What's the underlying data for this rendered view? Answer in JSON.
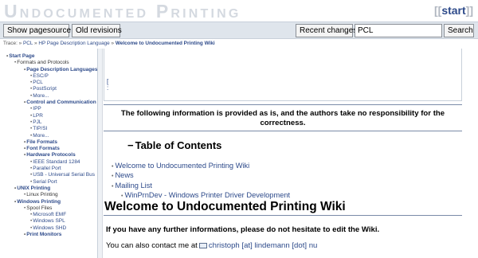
{
  "header": {
    "site_title": "Undocumented Printing",
    "start_prefix": "[[",
    "start_link": "start",
    "start_suffix": "]]"
  },
  "toolbar": {
    "show_pagesource": "Show pagesource",
    "old_revisions": "Old revisions",
    "recent_changes": "Recent changes",
    "search_value": "PCL",
    "search_button": "Search"
  },
  "trace": {
    "label": "Trace:",
    "items": [
      "PCL",
      "HP Page Description Language"
    ],
    "current": "Welcome to Undocumented Printing Wiki"
  },
  "sidebar": {
    "items": [
      {
        "label": "Start Page",
        "level": 0
      },
      {
        "label": "Formats and Protocols",
        "level": 1
      },
      {
        "label": "Page Description Languages",
        "level": 2
      },
      {
        "label": "ESC/P",
        "level": 3
      },
      {
        "label": "PCL",
        "level": 3
      },
      {
        "label": "PostScript",
        "level": 3
      },
      {
        "label": "More...",
        "level": 3
      },
      {
        "label": "Control and Communication",
        "level": 2
      },
      {
        "label": "IPP",
        "level": 3
      },
      {
        "label": "LPR",
        "level": 3
      },
      {
        "label": "PJL",
        "level": 3
      },
      {
        "label": "TIP/SI",
        "level": 3
      },
      {
        "label": "More...",
        "level": 3
      },
      {
        "label": "File Formats",
        "level": 2
      },
      {
        "label": "Font Formats",
        "level": 2
      },
      {
        "label": "Hardware Protocols",
        "level": 2
      },
      {
        "label": "IEEE Standard 1284",
        "level": 3
      },
      {
        "label": "Parallel Port",
        "level": 3
      },
      {
        "label": "USB - Universal Serial Bus",
        "level": 3
      },
      {
        "label": "Serial Port",
        "level": 3
      },
      {
        "label": "UNIX Printing",
        "level": 1
      },
      {
        "label": "Linux Printing",
        "level": 2
      },
      {
        "label": "Windows Printing",
        "level": 1
      },
      {
        "label": "Spool Files",
        "level": 2
      },
      {
        "label": "Microsoft EMF",
        "level": 3
      },
      {
        "label": "Windows SPL",
        "level": 3
      },
      {
        "label": "Windows SHD",
        "level": 3
      },
      {
        "label": "Print Monitors",
        "level": 2
      }
    ]
  },
  "content": {
    "notice": "The following information is provided as is, and the authors take no responsibility for the correctness.",
    "toc_title": "Table of Contents",
    "toc_minus": "−",
    "toc_items": [
      {
        "label": "Welcome to Undocumented Printing Wiki",
        "sub": false
      },
      {
        "label": "News",
        "sub": false
      },
      {
        "label": "Mailing List",
        "sub": false
      },
      {
        "label": "WinPrnDev - Windows Printer Driver Development",
        "sub": true
      }
    ],
    "heading": "Welcome to Undocumented Printing Wiki",
    "paragraph1": "If you have any further informations, please do not hesitate to edit the Wiki.",
    "contact_text": "You can also contact me at",
    "contact_email": "christoph [at] lindemann [dot] nu"
  }
}
